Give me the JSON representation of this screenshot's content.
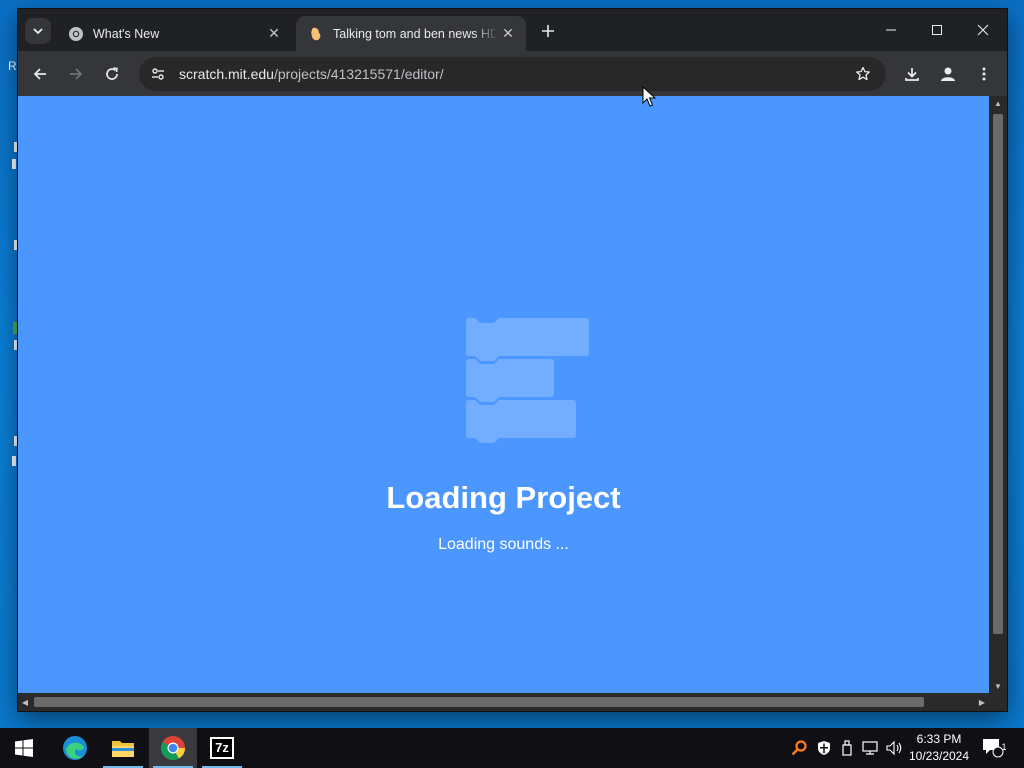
{
  "browser": {
    "tabs": [
      {
        "title": "What's New",
        "active": false,
        "favicon": "chrome-icon"
      },
      {
        "title": "Talking tom and ben news HD c",
        "active": true,
        "favicon": "scratch-icon"
      }
    ],
    "address": {
      "host": "scratch.mit.edu",
      "path": "/projects/413215571/editor/"
    }
  },
  "page": {
    "background": "#4c97ff",
    "loading_title": "Loading Project",
    "loading_message": "Loading sounds ..."
  },
  "taskbar": {
    "apps": [
      "start-icon",
      "edge-icon",
      "file-explorer-icon",
      "chrome-icon",
      "7zip-icon"
    ],
    "seven_zip_label": "7z",
    "clock": {
      "time": "6:33 PM",
      "date": "10/23/2024"
    },
    "notification_count": "1"
  },
  "colors": {
    "desktop": "#0b7fd6",
    "chrome_dark": "#202124",
    "toolbar": "#35363a",
    "scratch_blue": "#4c97ff"
  }
}
